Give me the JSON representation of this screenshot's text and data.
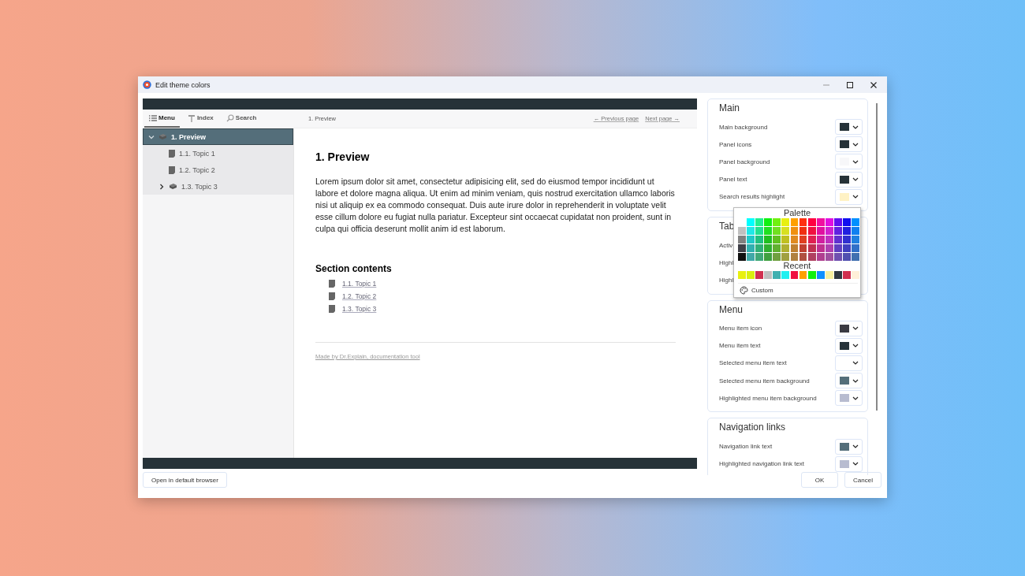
{
  "window": {
    "title": "Edit theme colors"
  },
  "preview": {
    "tabs": [
      {
        "label": "Menu",
        "kind": "menu",
        "selected": true
      },
      {
        "label": "Index",
        "kind": "index",
        "selected": false
      },
      {
        "label": "Search",
        "kind": "search",
        "selected": false
      }
    ],
    "breadcrumb": "1. Preview",
    "nav_links": [
      "← Previous page",
      "Next page →"
    ],
    "tree": [
      {
        "label": "1. Preview",
        "kind": "book",
        "expanded": true,
        "selected": true,
        "children": [
          {
            "label": "1.1. Topic 1",
            "kind": "page",
            "selected": false
          },
          {
            "label": "1.2. Topic 2",
            "kind": "page",
            "selected": false
          },
          {
            "label": "1.3. Topic 3",
            "kind": "book",
            "expanded": false,
            "selected": false
          }
        ]
      }
    ],
    "heading": "1. Preview",
    "paragraph": "Lorem ipsum dolor sit amet, consectetur adipisicing elit, sed do eiusmod tempor incididunt ut labore et dolore magna aliqua. Ut enim ad minim veniam, quis nostrud exercitation ullamco laboris nisi ut aliquip ex ea commodo consequat. Duis aute irure dolor in reprehenderit in voluptate velit esse cillum dolore eu fugiat nulla pariatur. Excepteur sint occaecat cupidatat non proident, sunt in culpa qui officia deserunt mollit anim id est laborum.",
    "section_title": "Section contents",
    "section_links": [
      "1.1. Topic 1",
      "1.2. Topic 2",
      "1.3. Topic 3"
    ],
    "footer_link": "Made by Dr.Explain, documentation tool"
  },
  "settings": {
    "sections": [
      {
        "title": "Main",
        "rows": [
          {
            "label": "Main background",
            "color": "#263238"
          },
          {
            "label": "Panel icons",
            "color": "#263238"
          },
          {
            "label": "Panel background",
            "color": "#f7f7f9"
          },
          {
            "label": "Panel text",
            "color": "#263238"
          },
          {
            "label": "Search results highlight",
            "color": "#fff2c4"
          }
        ]
      },
      {
        "title": "Tab",
        "rows": [
          {
            "label": "Activ"
          },
          {
            "label": "Highl"
          },
          {
            "label": "Highl"
          }
        ]
      },
      {
        "title": "Menu",
        "rows": [
          {
            "label": "Menu item icon",
            "color": "#3a3a42"
          },
          {
            "label": "Menu item text",
            "color": "#263238"
          },
          {
            "label": "Selected menu item text",
            "color": "#ffffff"
          },
          {
            "label": "Selected menu item background",
            "color": "#546e7a"
          },
          {
            "label": "Highlighted menu item background",
            "color": "#b8bcd0"
          }
        ]
      },
      {
        "title": "Navigation links",
        "rows": [
          {
            "label": "Navigation link text",
            "color": "#546e7a"
          },
          {
            "label": "Highlighted navigation link text",
            "color": "#b8bcd0"
          }
        ]
      }
    ]
  },
  "color_picker": {
    "palette_title": "Palette",
    "recent_title": "Recent",
    "custom_label": "Custom",
    "palette": [
      [
        {
          "color": "#00ffff"
        },
        {
          "color": "#20f090"
        },
        {
          "color": "#10f010"
        },
        {
          "color": "#70f010"
        },
        {
          "color": "#e8f010"
        },
        {
          "color": "#ffa000"
        },
        {
          "color": "#ff3010"
        },
        {
          "color": "#ff0040"
        },
        {
          "color": "#f010a0"
        },
        {
          "color": "#e010e0"
        },
        {
          "color": "#6010f0"
        },
        {
          "color": "#1010f0"
        },
        {
          "color": "#0090ff"
        }
      ],
      [
        {
          "color": "#c0c0c0"
        },
        {
          "color": "#20e8e8"
        },
        {
          "color": "#20e090"
        },
        {
          "color": "#20e020"
        },
        {
          "color": "#70e020"
        },
        {
          "color": "#d8e020"
        },
        {
          "color": "#f09010"
        },
        {
          "color": "#f03010"
        },
        {
          "color": "#f01040"
        },
        {
          "color": "#e010a0"
        },
        {
          "color": "#d020d0"
        },
        {
          "color": "#6020e0"
        },
        {
          "color": "#2020e0"
        },
        {
          "color": "#1080f0"
        }
      ],
      [
        {
          "color": "#808080"
        },
        {
          "color": "#20c8c8"
        },
        {
          "color": "#20c080"
        },
        {
          "color": "#20c020"
        },
        {
          "color": "#60c020"
        },
        {
          "color": "#c0c020"
        },
        {
          "color": "#e08a20"
        },
        {
          "color": "#e04020"
        },
        {
          "color": "#e02050"
        },
        {
          "color": "#d020a0"
        },
        {
          "color": "#c030c0"
        },
        {
          "color": "#6030d0"
        },
        {
          "color": "#3030d0"
        },
        {
          "color": "#2080e0"
        }
      ],
      [
        {
          "color": "#404048"
        },
        {
          "color": "#30b0b0"
        },
        {
          "color": "#30b078"
        },
        {
          "color": "#30b030"
        },
        {
          "color": "#60b030"
        },
        {
          "color": "#b0b030"
        },
        {
          "color": "#c08030"
        },
        {
          "color": "#c04030"
        },
        {
          "color": "#c03050"
        },
        {
          "color": "#c03090"
        },
        {
          "color": "#b040b0"
        },
        {
          "color": "#6040c0"
        },
        {
          "color": "#4040c0"
        },
        {
          "color": "#3070c8"
        }
      ],
      [
        {
          "color": "#101010"
        },
        {
          "color": "#40a8a8"
        },
        {
          "color": "#40a878"
        },
        {
          "color": "#40a040"
        },
        {
          "color": "#70a040"
        },
        {
          "color": "#a0a040"
        },
        {
          "color": "#b08040"
        },
        {
          "color": "#b05040"
        },
        {
          "color": "#b04060"
        },
        {
          "color": "#b04090"
        },
        {
          "color": "#a050a0"
        },
        {
          "color": "#7050b0"
        },
        {
          "color": "#5050b0"
        },
        {
          "color": "#4070b0"
        }
      ]
    ],
    "recent": [
      {
        "color": "#e8f010"
      },
      {
        "color": "#d8f010"
      },
      {
        "color": "#d03050"
      },
      {
        "color": "#c0c0c0"
      },
      {
        "color": "#40b0b0"
      },
      {
        "color": "#20f0f0"
      },
      {
        "color": "#f01040"
      },
      {
        "color": "#ffa000"
      },
      {
        "color": "#10f010"
      },
      {
        "color": "#1090ff"
      },
      {
        "color": "#f8f0a0"
      },
      {
        "color": "#303840"
      },
      {
        "color": "#d03050"
      },
      {
        "color": "#fff0d8"
      }
    ]
  },
  "buttons": {
    "open_browser": "Open in default browser",
    "ok": "OK",
    "cancel": "Cancel"
  }
}
